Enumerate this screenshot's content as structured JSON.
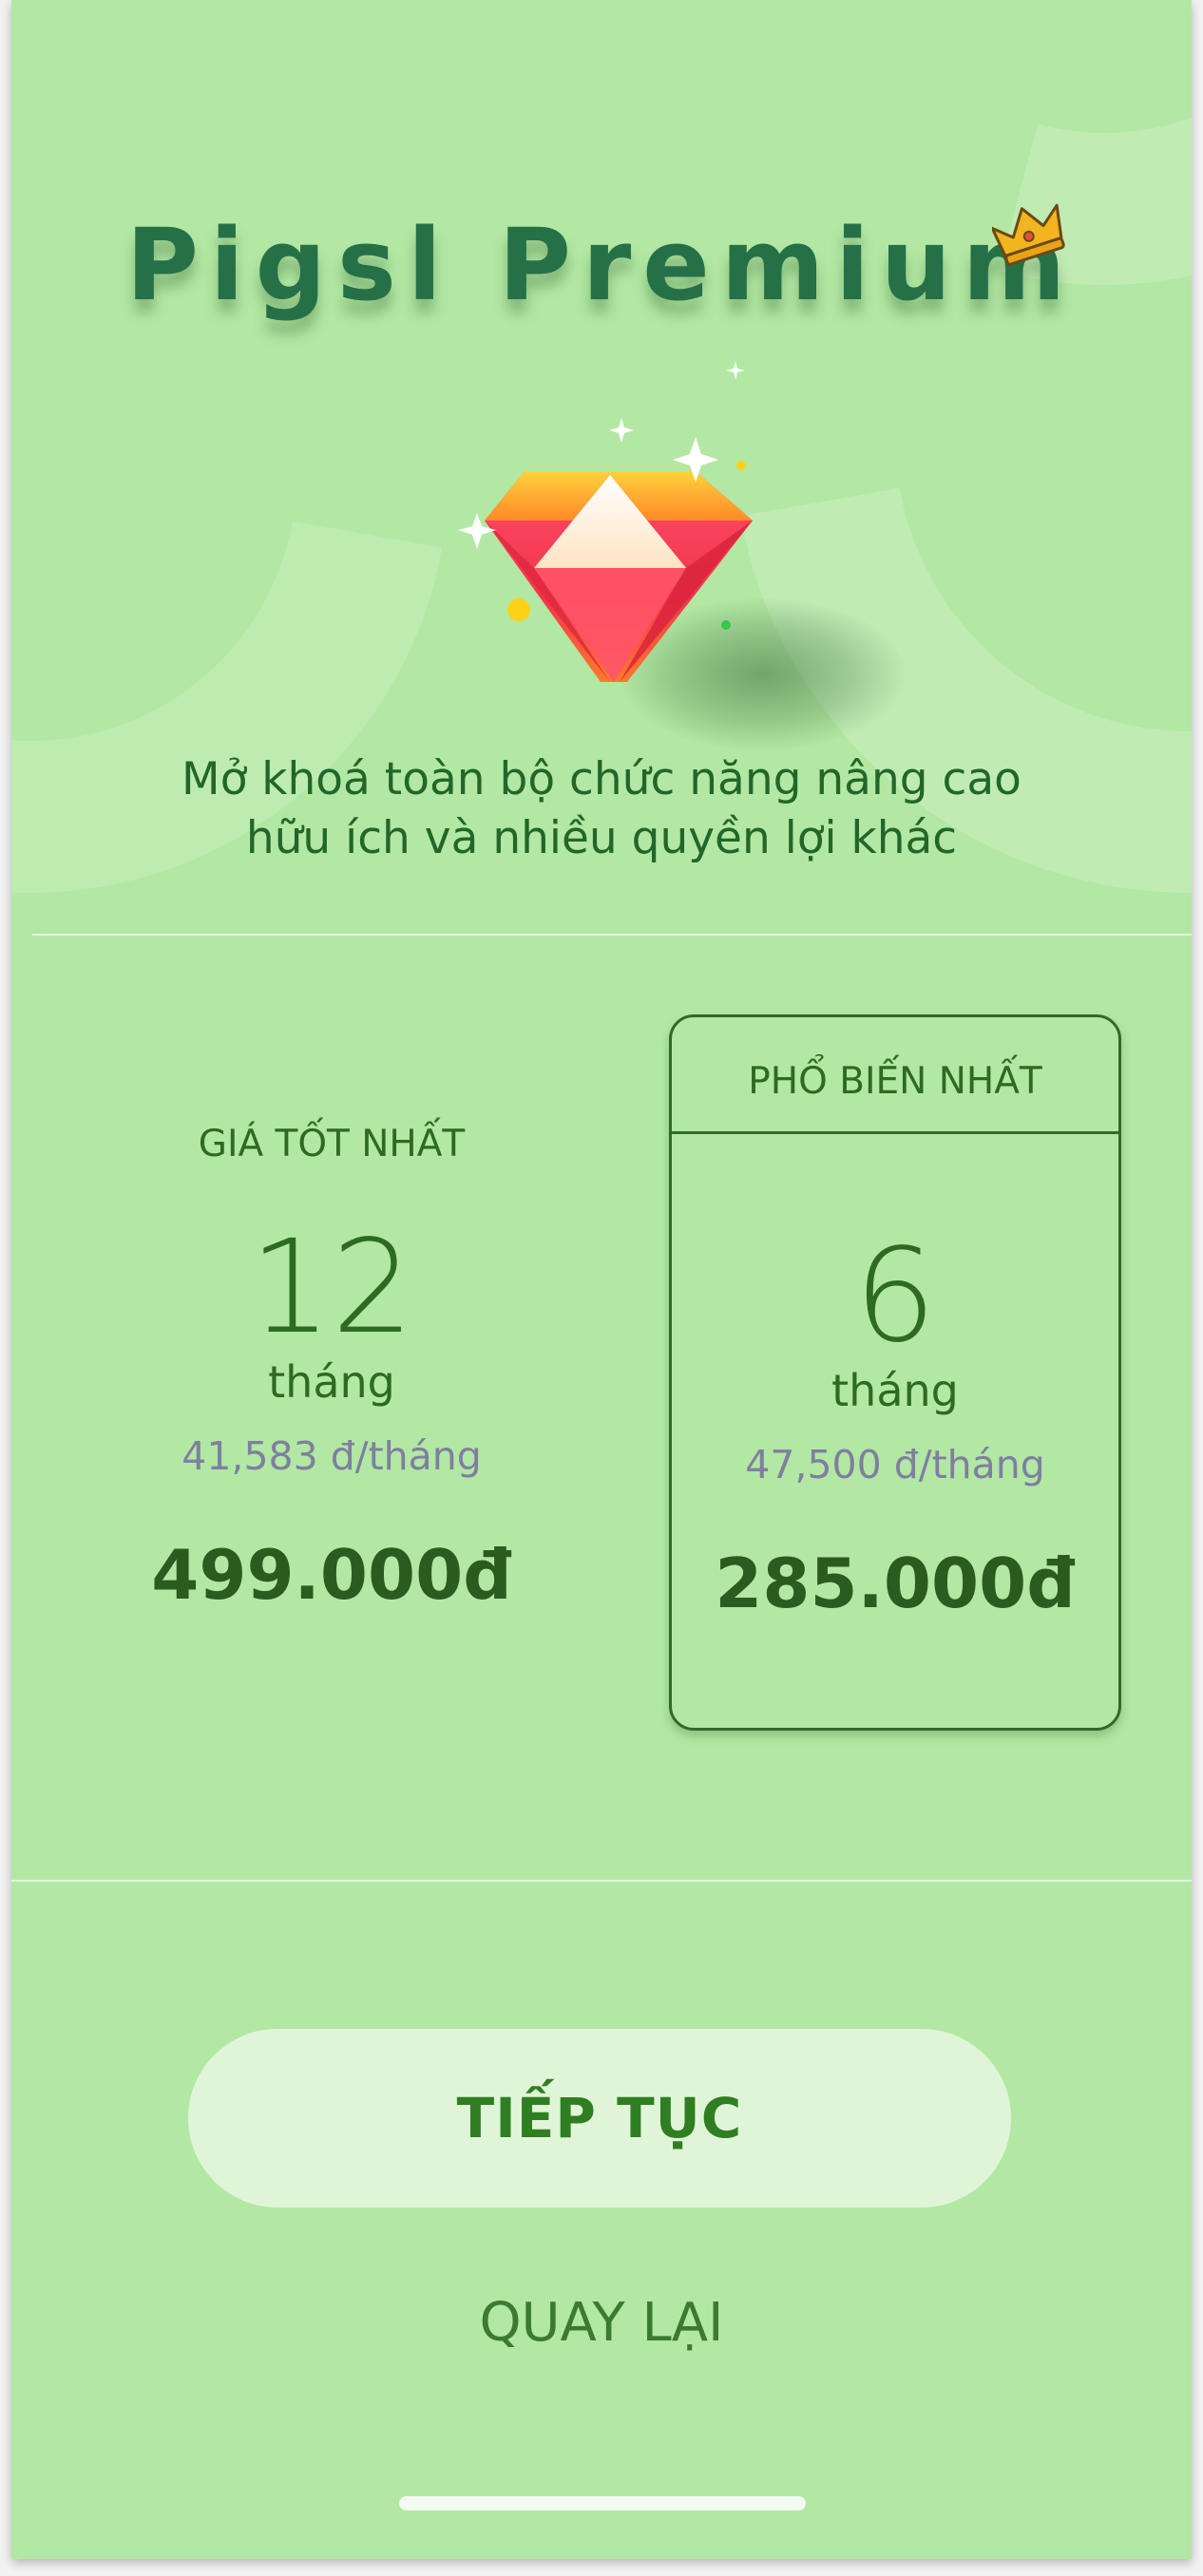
{
  "header": {
    "title": "Pigsl Premium",
    "subtitle_line1": "Mở khoá toàn bộ chức năng nâng cao",
    "subtitle_line2": "hữu ích và nhiều quyền lợi khác"
  },
  "icons": {
    "crown": "crown-icon",
    "gem": "diamond-gem-icon"
  },
  "plans": [
    {
      "label": "GIÁ TỐT NHẤT",
      "duration": "12",
      "unit": "tháng",
      "monthly_price": "41,583 đ/tháng",
      "total_price": "499.000đ",
      "selected": false
    },
    {
      "label": "PHỔ BIẾN NHẤT",
      "duration": "6",
      "unit": "tháng",
      "monthly_price": "47,500 đ/tháng",
      "total_price": "285.000đ",
      "selected": true
    }
  ],
  "actions": {
    "continue_label": "TIẾP TỤC",
    "back_label": "QUAY LẠI"
  },
  "colors": {
    "background": "#b2e8a3",
    "title": "#267048",
    "accent_green": "#2f7f22",
    "monthly_text": "#7f7fa0",
    "button_bg": "#e0f5d8"
  }
}
